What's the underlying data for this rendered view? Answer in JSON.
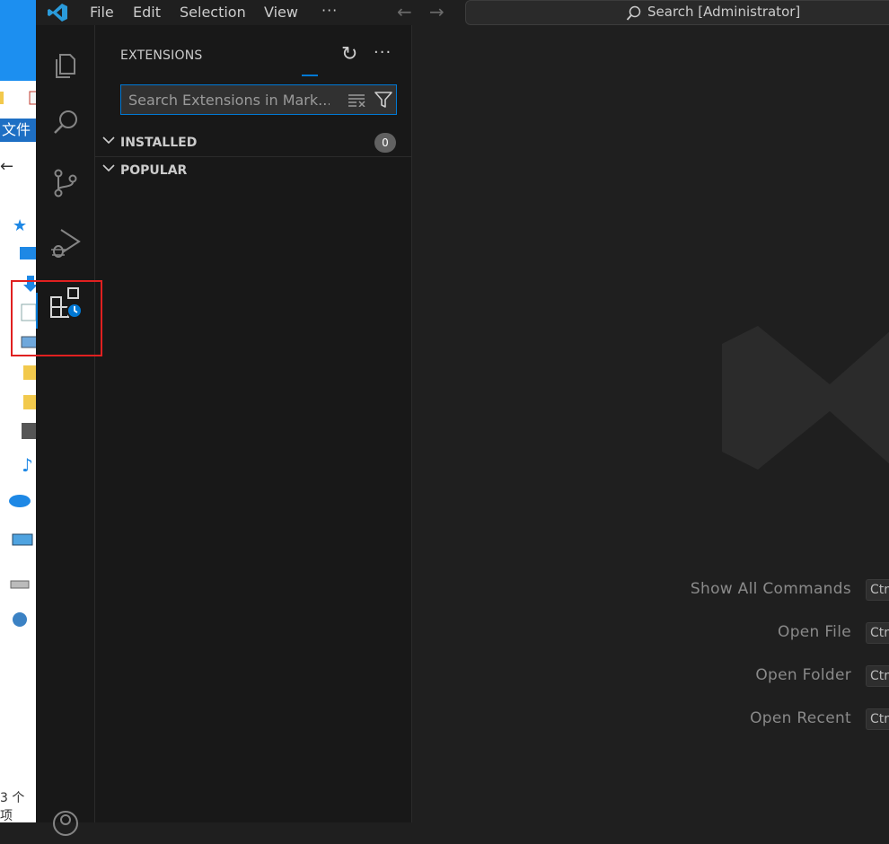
{
  "background_window": {
    "file_tab_label": "文件",
    "back_arrow": "←",
    "status_text": "3 个项"
  },
  "titlebar": {
    "menu": [
      "File",
      "Edit",
      "Selection",
      "View"
    ],
    "more": "···",
    "back": "←",
    "forward": "→",
    "search_label": "Search [Administrator]"
  },
  "activity_bar": {
    "items": [
      "explorer-icon",
      "search-icon",
      "source-control-icon",
      "run-debug-icon",
      "extensions-icon",
      "accounts-icon"
    ],
    "active": "extensions-icon"
  },
  "sidebar": {
    "title": "EXTENSIONS",
    "refresh": "↻",
    "more": "···",
    "search_placeholder": "Search Extensions in Mark...",
    "sections": [
      {
        "label": "INSTALLED",
        "badge": "0"
      },
      {
        "label": "POPULAR"
      }
    ]
  },
  "editor": {
    "shortcuts": [
      {
        "label": "Show All Commands",
        "key": "Ctrl"
      },
      {
        "label": "Open File",
        "key": "Ctrl"
      },
      {
        "label": "Open Folder",
        "key": "Ctrl"
      },
      {
        "label": "Open Recent",
        "key": "Ctrl"
      }
    ]
  },
  "colors": {
    "accent": "#0078d4",
    "highlight_box": "#e02020",
    "activity_bar_bg": "#181818",
    "editor_bg": "#1f1f1f"
  }
}
